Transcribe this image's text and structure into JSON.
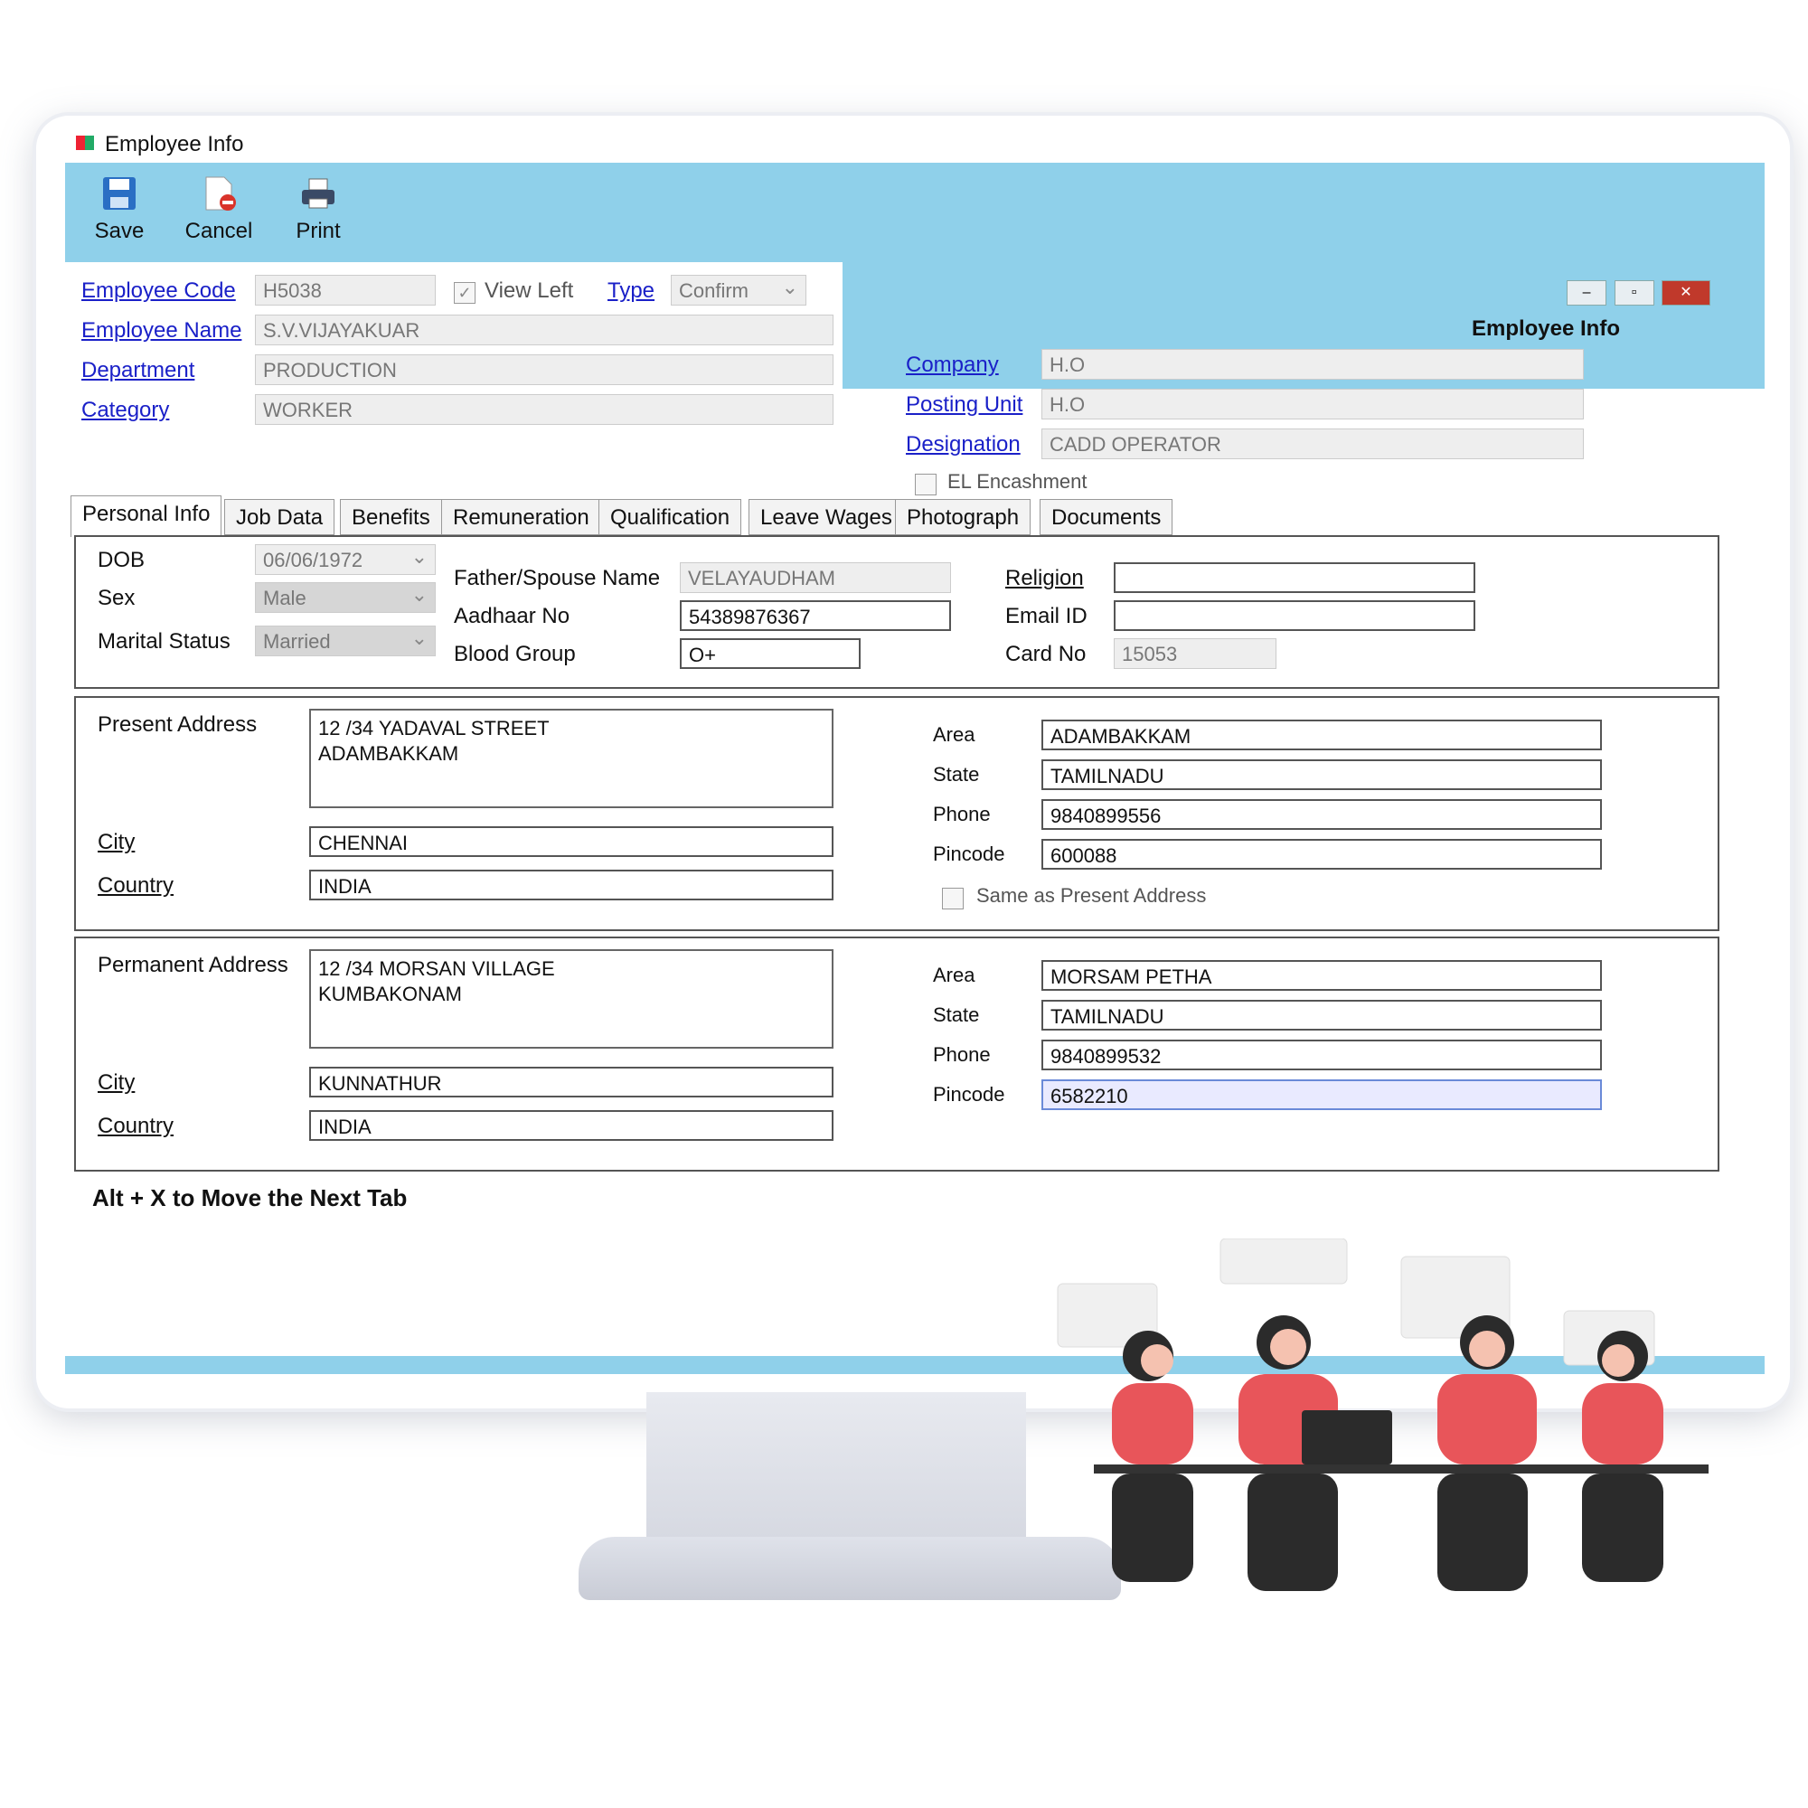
{
  "window": {
    "title": "Employee Info",
    "caption": "Employee Info",
    "controls": [
      "–",
      "▫",
      "✕"
    ]
  },
  "toolbar": {
    "save_label": "Save",
    "cancel_label": "Cancel",
    "print_label": "Print"
  },
  "header": {
    "employee_code_label": "Employee Code",
    "employee_code_value": "H5038",
    "view_left_label": "View Left",
    "view_left_checked": true,
    "type_label": "Type",
    "type_value": "Confirm",
    "employee_name_label": "Employee Name",
    "employee_name_value": "S.V.VIJAYAKUAR",
    "department_label": "Department",
    "department_value": "PRODUCTION",
    "category_label": "Category",
    "category_value": "WORKER",
    "company_label": "Company",
    "company_value": "H.O",
    "posting_unit_label": "Posting Unit",
    "posting_unit_value": "H.O",
    "designation_label": "Designation",
    "designation_value": "CADD OPERATOR",
    "el_encashment_label": "EL Encashment",
    "el_encashment_checked": false
  },
  "tabs": [
    {
      "label": "Personal Info"
    },
    {
      "label": "Job Data"
    },
    {
      "label": "Benefits"
    },
    {
      "label": "Remuneration"
    },
    {
      "label": "Qualification"
    },
    {
      "label": "Leave Wages"
    },
    {
      "label": "Photograph"
    },
    {
      "label": "Documents"
    }
  ],
  "personal": {
    "dob_label": "DOB",
    "dob_value": "06/06/1972",
    "sex_label": "Sex",
    "sex_value": "Male",
    "marital_label": "Marital Status",
    "marital_value": "Married",
    "father_label": "Father/Spouse Name",
    "father_value": "VELAYAUDHAM",
    "aadhaar_label": "Aadhaar No",
    "aadhaar_value": "54389876367",
    "blood_label": "Blood Group",
    "blood_value": "O+",
    "religion_label": "Religion",
    "religion_value": "",
    "email_label": "Email ID",
    "email_value": "",
    "card_label": "Card No",
    "card_value": "15053"
  },
  "present_address": {
    "label": "Present Address",
    "line1": "12 /34 YADAVAL STREET",
    "line2": "ADAMBAKKAM",
    "city_label": "City",
    "city_value": "CHENNAI",
    "country_label": "Country",
    "country_value": "INDIA",
    "area_label": "Area",
    "area_value": "ADAMBAKKAM",
    "state_label": "State",
    "state_value": "TAMILNADU",
    "phone_label": "Phone",
    "phone_value": "9840899556",
    "pincode_label": "Pincode",
    "pincode_value": "600088",
    "same_label": "Same as Present Address"
  },
  "permanent_address": {
    "label": "Permanent Address",
    "line1": "12 /34 MORSAN VILLAGE",
    "line2": "KUMBAKONAM",
    "city_label": "City",
    "city_value": "KUNNATHUR",
    "country_label": "Country",
    "country_value": "INDIA",
    "area_label": "Area",
    "area_value": "MORSAM PETHA",
    "state_label": "State",
    "state_value": "TAMILNADU",
    "phone_label": "Phone",
    "phone_value": "9840899532",
    "pincode_label": "Pincode",
    "pincode_value": "6582210"
  },
  "footer": {
    "hint": "Alt + X to Move the Next Tab"
  },
  "colors": {
    "accent": "#8fd0ea",
    "link": "#1a20c8",
    "people_shirt": "#e8555a",
    "people_pants": "#222222"
  }
}
